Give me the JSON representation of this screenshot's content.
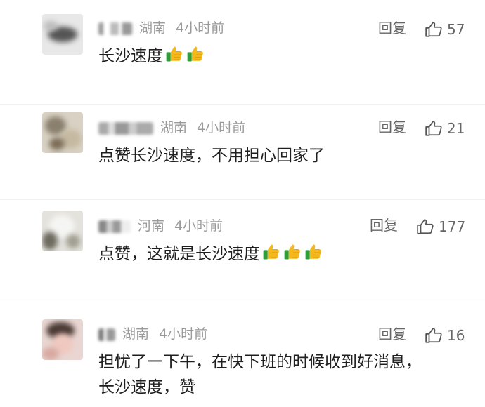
{
  "comments": [
    {
      "region": "湖南",
      "time": "4小时前",
      "reply_label": "回复",
      "likes": "57",
      "text": "长沙速度",
      "emoji_count": 2
    },
    {
      "region": "湖南",
      "time": "4小时前",
      "reply_label": "回复",
      "likes": "21",
      "text": "点赞长沙速度，不用担心回家了",
      "emoji_count": 0
    },
    {
      "region": "河南",
      "time": "4小时前",
      "reply_label": "回复",
      "likes": "177",
      "text": "点赞，这就是长沙速度",
      "emoji_count": 3
    },
    {
      "region": "湖南",
      "time": "4小时前",
      "reply_label": "回复",
      "likes": "16",
      "text_line1": "担忧了一下午，在快下班的时候收到好消息，",
      "text_line2": "长沙速度，赞",
      "emoji_count": 0
    }
  ],
  "icons": {
    "like": "thumbs-up-outline-icon",
    "emoji": "thumbs-up-emoji-icon"
  },
  "colors": {
    "text": "#1f1f1f",
    "meta": "#9a9a9a",
    "action": "#666666"
  }
}
